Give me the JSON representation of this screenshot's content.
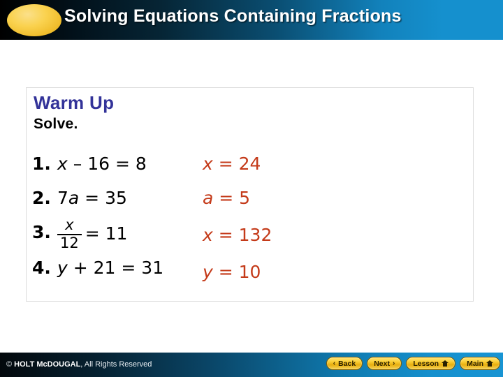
{
  "header": {
    "title": "Solving Equations Containing Fractions",
    "accent_ellipse_color": "#fad24f",
    "bar_gradient_end": "#1590ce"
  },
  "content": {
    "warmup_title": "Warm Up",
    "warmup_title_color": "#333399",
    "instruction": "Solve.",
    "answer_color": "#c43a19",
    "problems": [
      {
        "number": "1.",
        "equation": "x – 16 = 8",
        "variable": "x",
        "rest": " – 16 = 8",
        "answer_var": "x",
        "answer_rest": " = 24",
        "answer": "x = 24"
      },
      {
        "number": "2.",
        "equation": "7a = 35",
        "variable": "a",
        "lead": "7",
        "rest": " = 35",
        "answer_var": "a",
        "answer_rest": " = 5",
        "answer": "a = 5"
      },
      {
        "number": "3.",
        "equation": "x/12 = 11",
        "numerator": "x",
        "denominator": "12",
        "rest": "= 11",
        "answer_var": "x",
        "answer_rest": " = 132",
        "answer": "x = 132"
      },
      {
        "number": "4.",
        "equation": "y + 21 = 31",
        "variable": "y",
        "rest": " + 21 = 31",
        "answer_var": "y",
        "answer_rest": " = 10",
        "answer": "y = 10"
      }
    ]
  },
  "footer": {
    "copyright_symbol": "©",
    "brand": "HOLT McDOUGAL",
    "rights": ", All Rights Reserved",
    "buttons": [
      {
        "label": "Back",
        "chevron": "‹",
        "icon": "chevron-left-icon",
        "side": "left"
      },
      {
        "label": "Next",
        "chevron": "›",
        "icon": "chevron-right-icon",
        "side": "right"
      },
      {
        "label": "Lesson",
        "icon": "home-icon",
        "side": "right"
      },
      {
        "label": "Main",
        "icon": "home-icon",
        "side": "right"
      }
    ]
  }
}
